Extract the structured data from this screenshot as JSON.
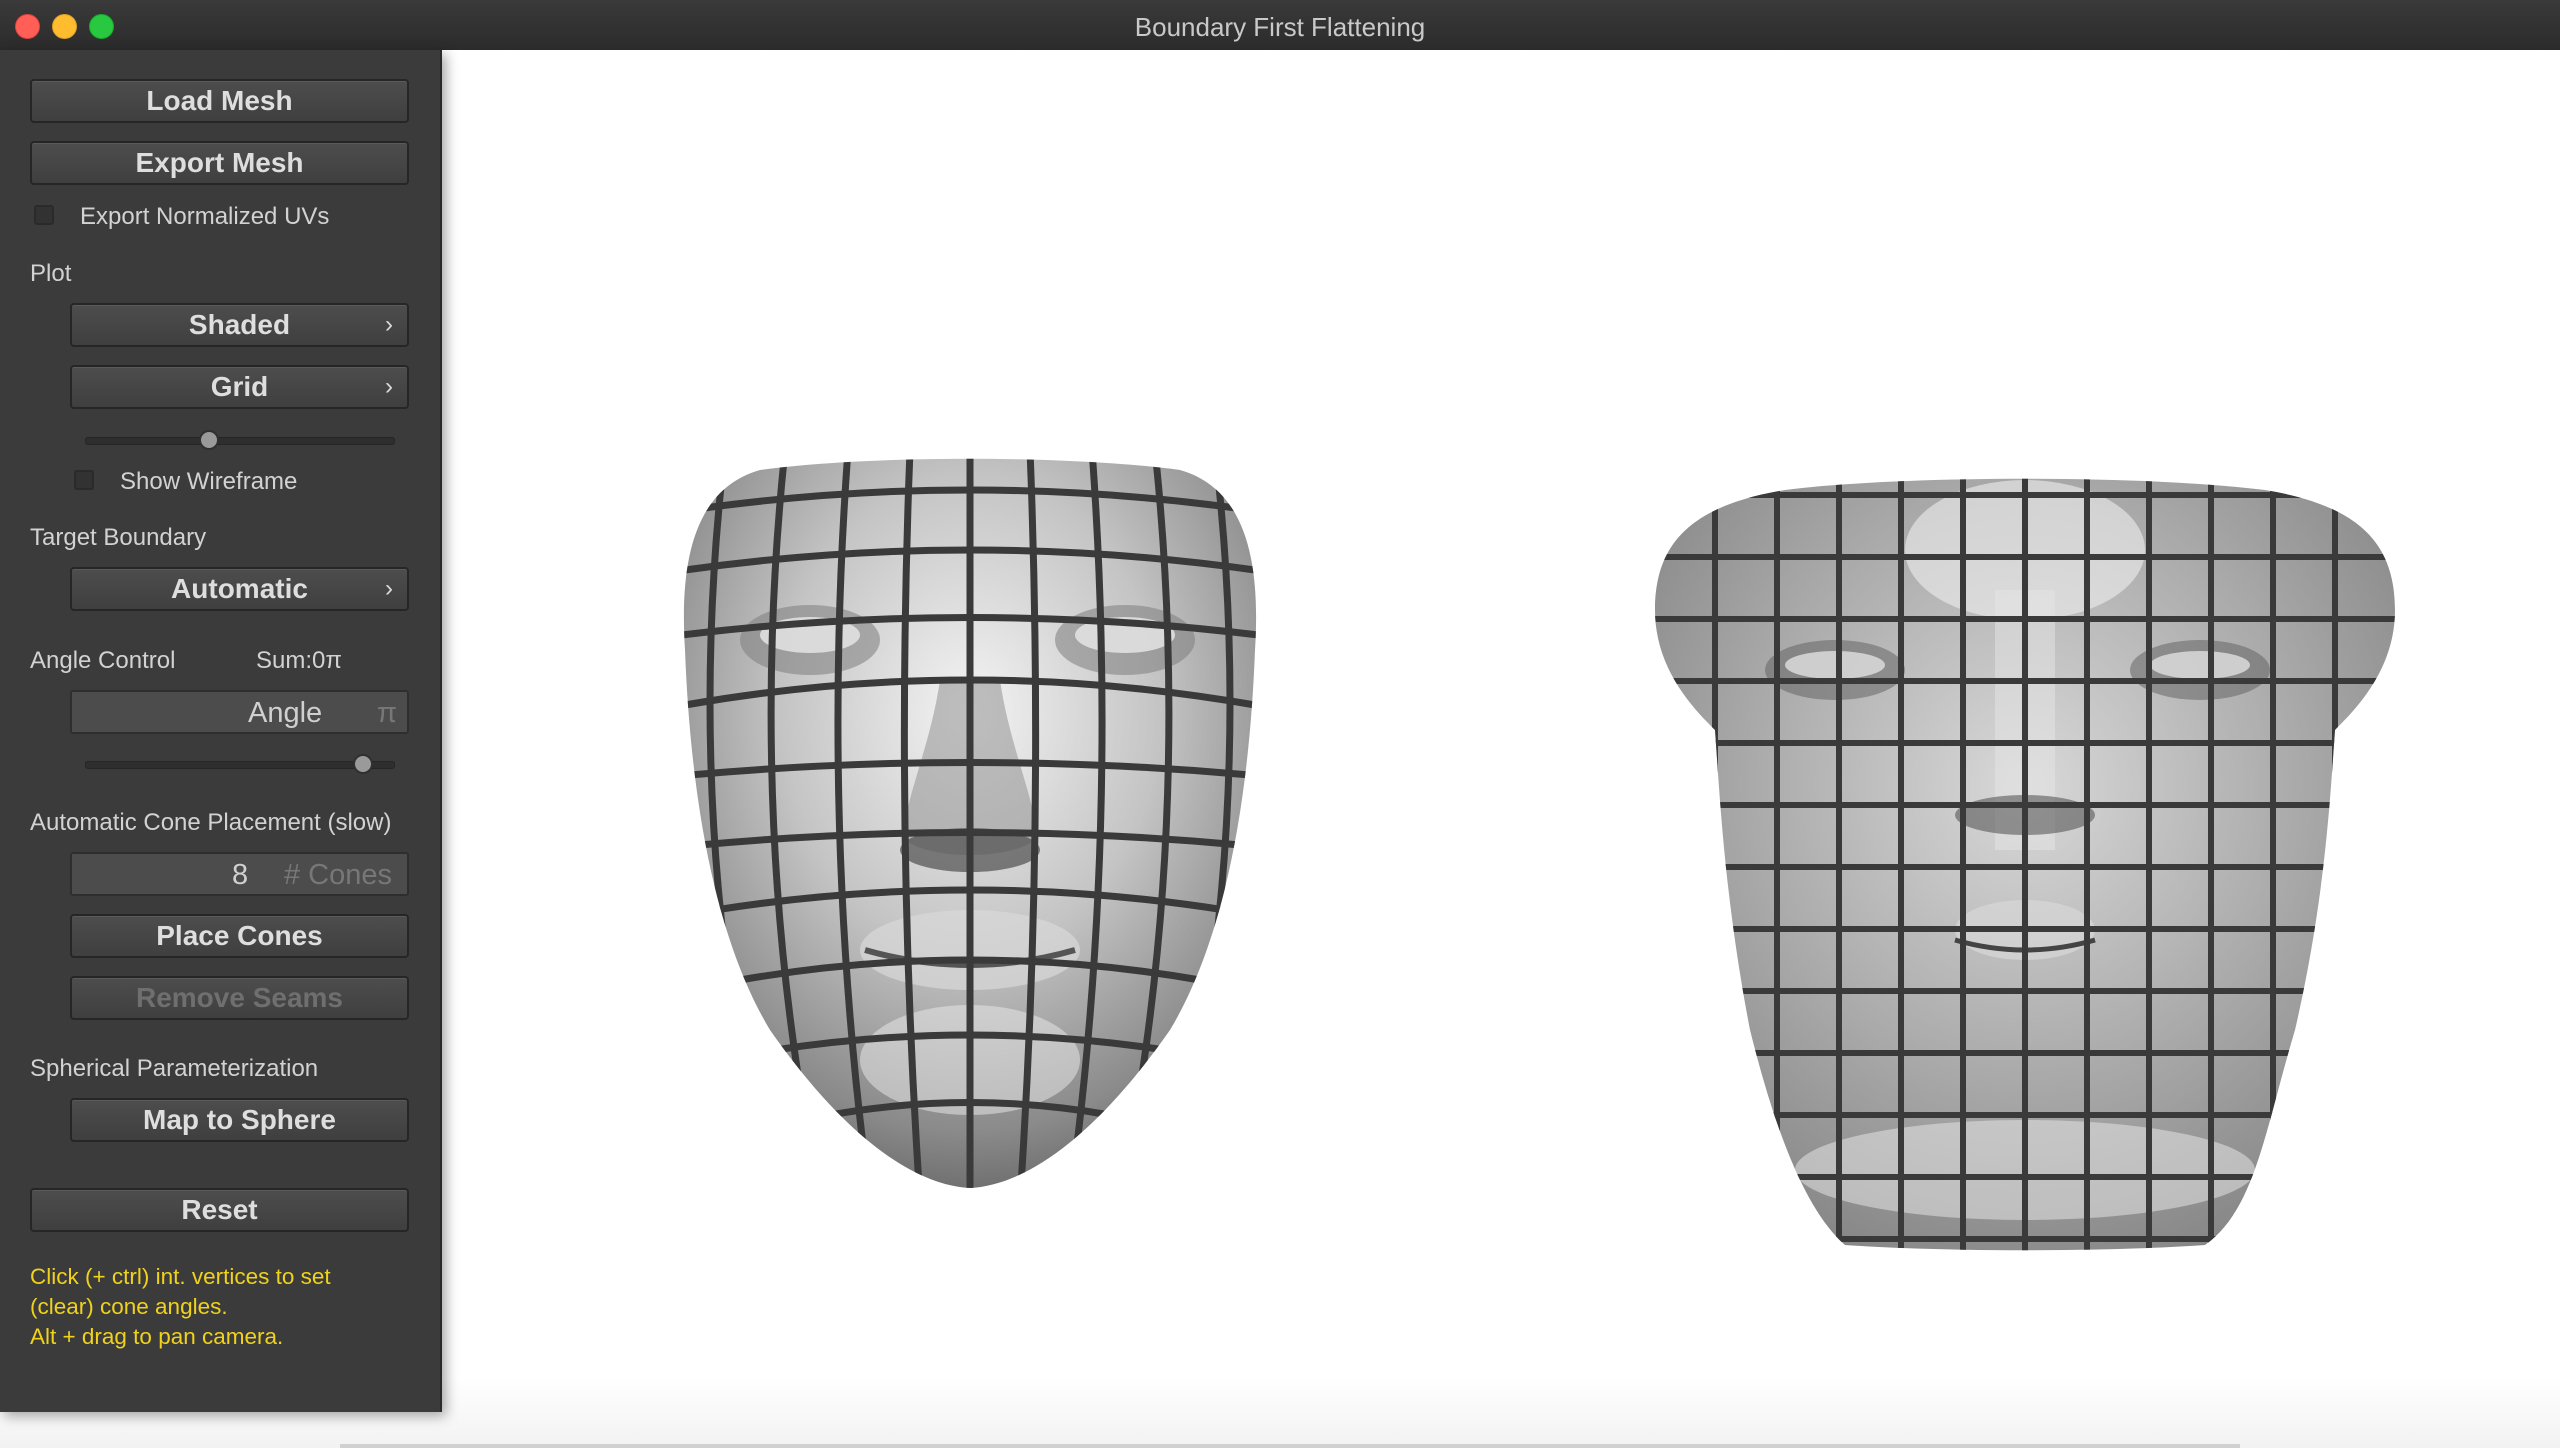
{
  "window": {
    "title": "Boundary First Flattening"
  },
  "panel": {
    "load_mesh": "Load Mesh",
    "export_mesh": "Export Mesh",
    "export_normalized_uvs": {
      "label": "Export Normalized UVs",
      "checked": false
    },
    "plot_label": "Plot",
    "plot_shading": "Shaded",
    "plot_pattern": "Grid",
    "pattern_scale_level": 0.4,
    "show_wireframe": {
      "label": "Show Wireframe",
      "checked": false
    },
    "target_boundary_label": "Target Boundary",
    "target_boundary_value": "Automatic",
    "angle_control_label": "Angle Control",
    "angle_sum": "Sum:0π",
    "angle_field": {
      "placeholder": "Angle",
      "unit": "π"
    },
    "angle_slider_level": 0.9,
    "cone_placement_label": "Automatic Cone Placement (slow)",
    "cones_field": {
      "value": "8",
      "unit": "# Cones"
    },
    "place_cones": "Place Cones",
    "remove_seams": "Remove Seams",
    "spherical_label": "Spherical Parameterization",
    "map_to_sphere": "Map to Sphere",
    "reset": "Reset",
    "hints": [
      "Click (+ ctrl) int. vertices to set",
      "(clear) cone angles.",
      "Alt + drag to pan camera."
    ]
  },
  "icons": {
    "dropdown": "chevron-right-icon",
    "close": "close-icon",
    "minimize": "minimize-icon",
    "maximize": "maximize-icon"
  },
  "colors": {
    "panel_bg": "#3b3b3b",
    "hint_text": "#f0d21c",
    "viewport_bg": "#ffffff",
    "grid_line": "#3a3a3a"
  }
}
